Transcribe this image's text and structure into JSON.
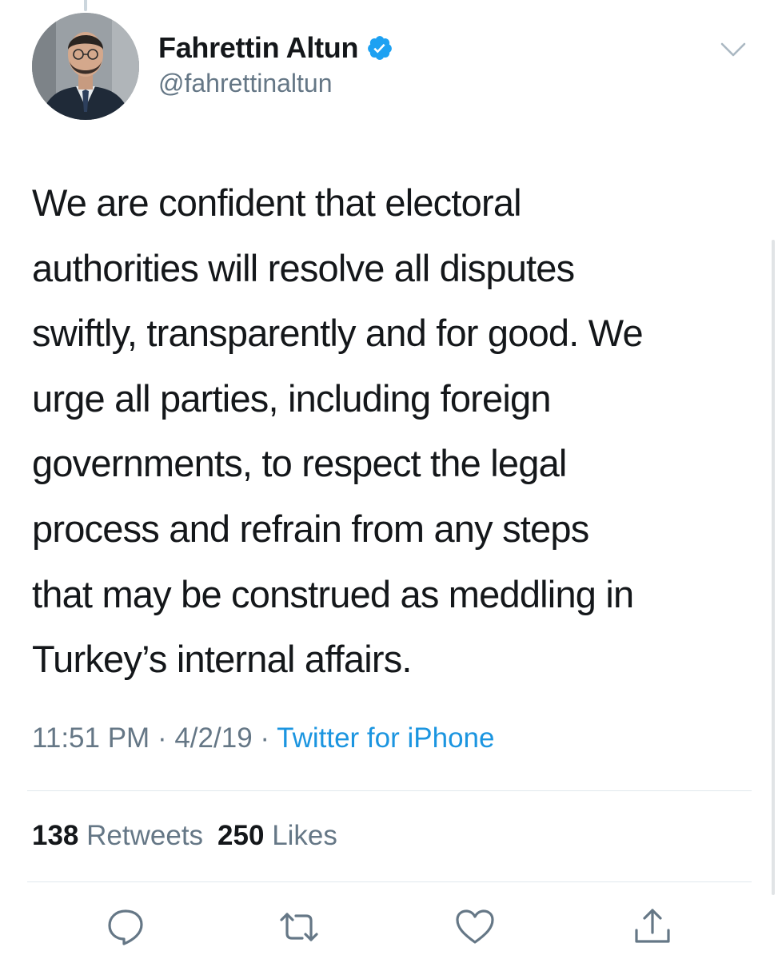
{
  "author": {
    "display_name": "Fahrettin Altun",
    "handle": "@fahrettinaltun",
    "verified": true
  },
  "tweet": {
    "text_lines": [
      "We are confident that electoral",
      "authorities will resolve all disputes",
      "swiftly, transparently and for good. We",
      "urge all parties, including foreign",
      "governments, to respect the legal",
      "process and refrain from any steps",
      "that may be construed as meddling in",
      "Turkey’s internal affairs."
    ],
    "time": "11:51 PM",
    "separator": "·",
    "date": "4/2/19",
    "source": "Twitter for iPhone"
  },
  "stats": {
    "retweets_count": "138",
    "retweets_label": "Retweets",
    "likes_count": "250",
    "likes_label": "Likes"
  },
  "actions": {
    "icons": [
      "reply-icon",
      "retweet-icon",
      "like-icon",
      "share-icon"
    ]
  },
  "colors": {
    "text": "#14171a",
    "secondary": "#657786",
    "link": "#1b95e0",
    "verified": "#1da1f2",
    "divider": "#e1e8ed"
  }
}
